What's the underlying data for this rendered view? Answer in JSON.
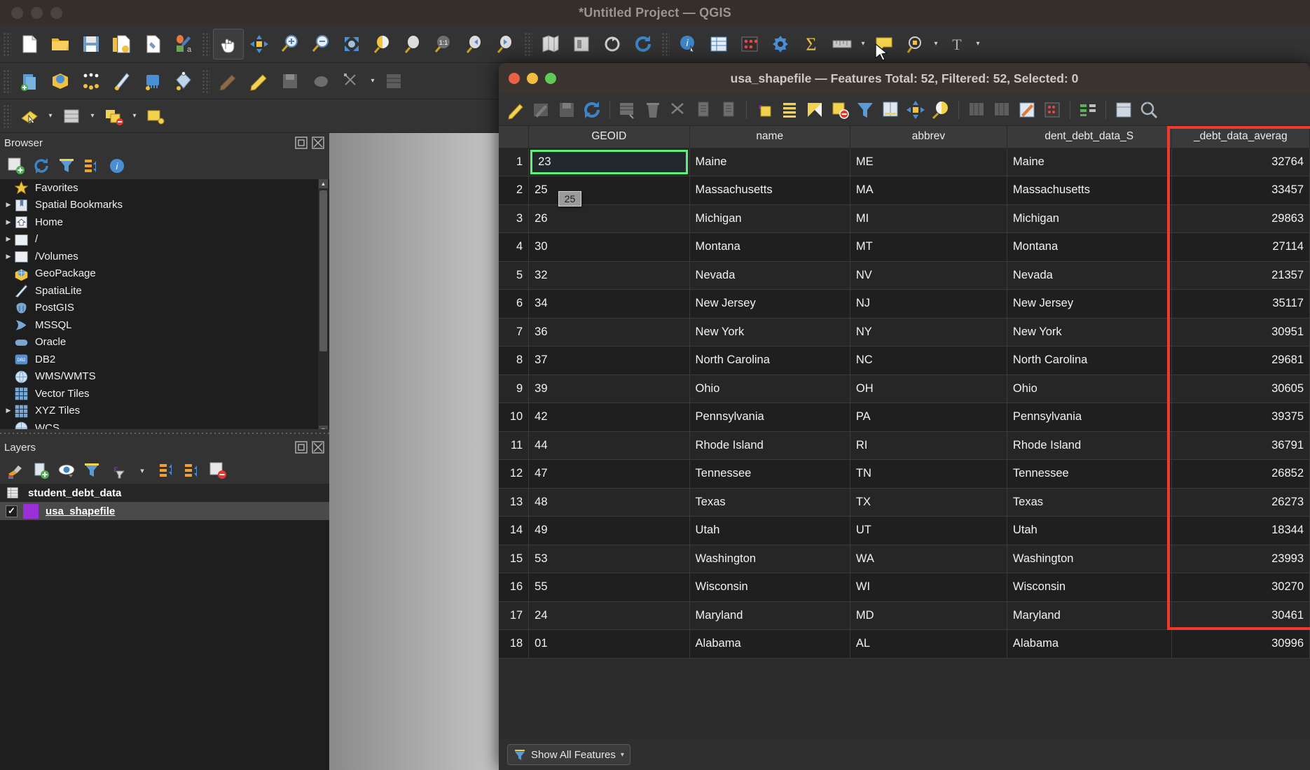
{
  "main_window": {
    "title": "*Untitled Project — QGIS",
    "traffic_lights": [
      "close",
      "minimize",
      "zoom"
    ]
  },
  "toolbar_rows": [
    {
      "name": "project-toolbar",
      "items": [
        {
          "icon": "new-project-icon",
          "label": "New Project"
        },
        {
          "icon": "open-project-icon",
          "label": "Open Project"
        },
        {
          "icon": "save-project-icon",
          "label": "Save Project"
        },
        {
          "icon": "new-print-layout-icon",
          "label": "New Print Layout"
        },
        {
          "icon": "style-manager-icon",
          "label": "Style Manager"
        },
        {
          "icon": "layout-manager-icon",
          "label": "Layout Manager"
        },
        {
          "sep": true
        },
        {
          "icon": "pan-map-icon",
          "label": "Pan Map",
          "active": true
        },
        {
          "icon": "pan-to-selection-icon",
          "label": "Pan Map to Selection"
        },
        {
          "icon": "zoom-in-icon",
          "label": "Zoom In"
        },
        {
          "icon": "zoom-out-icon",
          "label": "Zoom Out"
        },
        {
          "icon": "zoom-full-icon",
          "label": "Zoom Full"
        },
        {
          "icon": "zoom-selection-icon",
          "label": "Zoom to Selection"
        },
        {
          "icon": "zoom-layer-icon",
          "label": "Zoom to Layer"
        },
        {
          "icon": "zoom-native-icon",
          "label": "Zoom to Native Resolution"
        },
        {
          "icon": "zoom-last-icon",
          "label": "Zoom Last"
        },
        {
          "icon": "zoom-next-icon",
          "label": "Zoom Next"
        },
        {
          "sep": true
        },
        {
          "icon": "new-map-view-icon",
          "label": "New Map View"
        },
        {
          "icon": "new-3d-map-view-icon",
          "label": "New 3D Map View"
        },
        {
          "icon": "refresh-icon",
          "label": "Refresh"
        },
        {
          "icon": "reload-icon",
          "label": "Reload"
        },
        {
          "sep": true
        },
        {
          "icon": "identify-features-icon",
          "label": "Identify Features"
        },
        {
          "icon": "open-attribute-table-icon",
          "label": "Open Attribute Table"
        },
        {
          "icon": "statistical-summary-icon",
          "label": "Statistical Summary"
        },
        {
          "icon": "processing-toolbox-icon",
          "label": "Processing Toolbox"
        },
        {
          "icon": "sum-icon",
          "label": "Field Calculator"
        },
        {
          "icon": "measure-line-icon",
          "label": "Measure Line"
        },
        {
          "icon": "map-tips-icon",
          "label": "Show Map Tips"
        },
        {
          "icon": "annotations-icon",
          "label": "Annotations"
        },
        {
          "icon": "text-annotation-icon",
          "label": "Text Annotation"
        }
      ]
    },
    {
      "name": "data-source-toolbar",
      "items": [
        {
          "icon": "data-source-manager-icon",
          "label": "Data Source Manager"
        },
        {
          "icon": "add-vector-layer-icon",
          "label": "Add Vector Layer"
        },
        {
          "icon": "add-delimited-text-icon",
          "label": "Add Delimited Text Layer"
        },
        {
          "icon": "add-spatialite-icon",
          "label": "Add SpatiaLite Layer"
        },
        {
          "icon": "add-postgis-icon",
          "label": "Add PostGIS Layer"
        },
        {
          "icon": "add-mesh-layer-icon",
          "label": "Add Mesh Layer"
        },
        {
          "sep": true
        },
        {
          "icon": "current-edits-icon",
          "label": "Current Edits"
        },
        {
          "icon": "toggle-editing-icon",
          "label": "Toggle Editing"
        },
        {
          "icon": "save-layer-edits-icon",
          "label": "Save Layer Edits"
        },
        {
          "icon": "digitize-shape-icon",
          "label": "Digitize Shape"
        },
        {
          "icon": "vertex-tool-icon",
          "label": "Vertex Tool"
        },
        {
          "icon": "modify-attributes-icon",
          "label": "Modify Attributes of Features"
        }
      ]
    },
    {
      "name": "selection-toolbar",
      "items": [
        {
          "icon": "select-features-icon",
          "label": "Select Features by Area"
        },
        {
          "icon": "select-value-icon",
          "label": "Select Features by Value"
        },
        {
          "icon": "deselect-features-icon",
          "label": "Deselect Features"
        },
        {
          "icon": "select-by-location-icon",
          "label": "Select by Location"
        }
      ]
    }
  ],
  "browser_panel": {
    "title": "Browser",
    "toolbar": [
      {
        "icon": "add-layer-icon",
        "label": "Add Selected Layers"
      },
      {
        "icon": "refresh-icon",
        "label": "Refresh"
      },
      {
        "icon": "filter-browser-icon",
        "label": "Filter Browser"
      },
      {
        "icon": "collapse-all-icon",
        "label": "Collapse All"
      },
      {
        "icon": "properties-info-icon",
        "label": "Properties"
      }
    ],
    "items": [
      {
        "label": "Favorites",
        "icon": "star-icon",
        "expandable": false
      },
      {
        "label": "Spatial Bookmarks",
        "icon": "bookmark-icon",
        "expandable": true
      },
      {
        "label": "Home",
        "icon": "home-icon",
        "expandable": true
      },
      {
        "label": "/",
        "icon": "folder-icon",
        "expandable": true
      },
      {
        "label": "/Volumes",
        "icon": "folder-icon",
        "expandable": true
      },
      {
        "label": "GeoPackage",
        "icon": "geopackage-icon",
        "expandable": false
      },
      {
        "label": "SpatiaLite",
        "icon": "spatialite-icon",
        "expandable": false
      },
      {
        "label": "PostGIS",
        "icon": "postgis-icon",
        "expandable": false
      },
      {
        "label": "MSSQL",
        "icon": "mssql-icon",
        "expandable": false
      },
      {
        "label": "Oracle",
        "icon": "oracle-icon",
        "expandable": false
      },
      {
        "label": "DB2",
        "icon": "db2-icon",
        "expandable": false
      },
      {
        "label": "WMS/WMTS",
        "icon": "wms-icon",
        "expandable": false
      },
      {
        "label": "Vector Tiles",
        "icon": "vector-tiles-icon",
        "expandable": false
      },
      {
        "label": "XYZ Tiles",
        "icon": "xyz-tiles-icon",
        "expandable": true
      },
      {
        "label": "WCS",
        "icon": "wcs-icon",
        "expandable": false
      }
    ]
  },
  "layers_panel": {
    "title": "Layers",
    "toolbar": [
      {
        "icon": "layer-styling-icon",
        "label": "Open Layer Styling Panel"
      },
      {
        "icon": "add-group-icon",
        "label": "Add Group"
      },
      {
        "icon": "manage-visibility-icon",
        "label": "Manage Map Themes"
      },
      {
        "icon": "filter-legend-icon",
        "label": "Filter Legend"
      },
      {
        "icon": "expression-filter-icon",
        "label": "Filter Legend by Expression"
      },
      {
        "icon": "expand-all-icon",
        "label": "Expand All"
      },
      {
        "icon": "collapse-all-icon",
        "label": "Collapse All"
      },
      {
        "icon": "remove-layer-icon",
        "label": "Remove Layer/Group"
      }
    ],
    "layers": [
      {
        "name": "student_debt_data",
        "icon": "table-layer-icon",
        "checked": null,
        "selected": "dark",
        "color": null
      },
      {
        "name": "usa_shapefile",
        "icon": "polygon-layer-icon",
        "checked": true,
        "selected": "light",
        "color": "#9b30d9"
      }
    ]
  },
  "attribute_window": {
    "title": "usa_shapefile — Features Total: 52, Filtered: 52, Selected: 0",
    "toolbar": [
      {
        "icon": "toggle-editing-pencil-icon",
        "label": "Toggle Editing Mode"
      },
      {
        "icon": "multi-edit-icon",
        "label": "Toggle Multi Edit Mode"
      },
      {
        "icon": "save-edits-icon",
        "label": "Save Edits"
      },
      {
        "icon": "reload-table-icon",
        "label": "Reload Table"
      },
      {
        "sep": true
      },
      {
        "icon": "add-feature-icon",
        "label": "Add Feature"
      },
      {
        "icon": "delete-selected-icon",
        "label": "Delete Selected Features"
      },
      {
        "icon": "cut-features-icon",
        "label": "Cut Selected Features"
      },
      {
        "icon": "copy-features-icon",
        "label": "Copy Selected Features"
      },
      {
        "icon": "paste-features-icon",
        "label": "Paste Features"
      },
      {
        "sep": true
      },
      {
        "icon": "select-by-expression-icon",
        "label": "Select Features Using an Expression"
      },
      {
        "icon": "select-all-icon",
        "label": "Select All"
      },
      {
        "icon": "invert-selection-icon",
        "label": "Invert Selection"
      },
      {
        "icon": "deselect-all-icon",
        "label": "Deselect All"
      },
      {
        "icon": "filter-expression-icon",
        "label": "Filter / Select Using Form"
      },
      {
        "icon": "move-selection-top-icon",
        "label": "Move Selection to Top"
      },
      {
        "icon": "pan-to-selected-icon",
        "label": "Pan Map to Selected Rows"
      },
      {
        "icon": "zoom-to-selected-icon",
        "label": "Zoom Map to Selected Rows"
      },
      {
        "sep": true
      },
      {
        "icon": "new-field-icon",
        "label": "New Field"
      },
      {
        "icon": "delete-field-icon",
        "label": "Delete Field"
      },
      {
        "icon": "open-field-calculator-icon",
        "label": "Open Field Calculator"
      },
      {
        "icon": "conditional-formatting-icon",
        "label": "Conditional Formatting"
      },
      {
        "sep": true
      },
      {
        "icon": "organize-columns-icon",
        "label": "Organize Columns"
      },
      {
        "sep": true
      },
      {
        "icon": "actions-icon",
        "label": "Actions"
      },
      {
        "icon": "form-view-icon",
        "label": "Switch to Form View"
      }
    ],
    "columns": [
      "GEOID",
      "name",
      "abbrev",
      "dent_debt_data_S",
      "_debt_data_averag"
    ],
    "rows": [
      {
        "n": "1",
        "geoid": "23",
        "name": "Maine",
        "abbrev": "ME",
        "state": "Maine",
        "avg": "32764"
      },
      {
        "n": "2",
        "geoid": "25",
        "name": "Massachusetts",
        "abbrev": "MA",
        "state": "Massachusetts",
        "avg": "33457"
      },
      {
        "n": "3",
        "geoid": "26",
        "name": "Michigan",
        "abbrev": "MI",
        "state": "Michigan",
        "avg": "29863"
      },
      {
        "n": "4",
        "geoid": "30",
        "name": "Montana",
        "abbrev": "MT",
        "state": "Montana",
        "avg": "27114"
      },
      {
        "n": "5",
        "geoid": "32",
        "name": "Nevada",
        "abbrev": "NV",
        "state": "Nevada",
        "avg": "21357"
      },
      {
        "n": "6",
        "geoid": "34",
        "name": "New Jersey",
        "abbrev": "NJ",
        "state": "New Jersey",
        "avg": "35117"
      },
      {
        "n": "7",
        "geoid": "36",
        "name": "New York",
        "abbrev": "NY",
        "state": "New York",
        "avg": "30951"
      },
      {
        "n": "8",
        "geoid": "37",
        "name": "North Carolina",
        "abbrev": "NC",
        "state": "North Carolina",
        "avg": "29681"
      },
      {
        "n": "9",
        "geoid": "39",
        "name": "Ohio",
        "abbrev": "OH",
        "state": "Ohio",
        "avg": "30605"
      },
      {
        "n": "10",
        "geoid": "42",
        "name": "Pennsylvania",
        "abbrev": "PA",
        "state": "Pennsylvania",
        "avg": "39375"
      },
      {
        "n": "11",
        "geoid": "44",
        "name": "Rhode Island",
        "abbrev": "RI",
        "state": "Rhode Island",
        "avg": "36791"
      },
      {
        "n": "12",
        "geoid": "47",
        "name": "Tennessee",
        "abbrev": "TN",
        "state": "Tennessee",
        "avg": "26852"
      },
      {
        "n": "13",
        "geoid": "48",
        "name": "Texas",
        "abbrev": "TX",
        "state": "Texas",
        "avg": "26273"
      },
      {
        "n": "14",
        "geoid": "49",
        "name": "Utah",
        "abbrev": "UT",
        "state": "Utah",
        "avg": "18344"
      },
      {
        "n": "15",
        "geoid": "53",
        "name": "Washington",
        "abbrev": "WA",
        "state": "Washington",
        "avg": "23993"
      },
      {
        "n": "16",
        "geoid": "55",
        "name": "Wisconsin",
        "abbrev": "WI",
        "state": "Wisconsin",
        "avg": "30270"
      },
      {
        "n": "17",
        "geoid": "24",
        "name": "Maryland",
        "abbrev": "MD",
        "state": "Maryland",
        "avg": "30461"
      },
      {
        "n": "18",
        "geoid": "01",
        "name": "Alabama",
        "abbrev": "AL",
        "state": "Alabama",
        "avg": "30996"
      }
    ],
    "selected_cell": {
      "row": 1,
      "column": "GEOID",
      "value": "23"
    },
    "tooltip": "25",
    "highlight_color": "#f0392b",
    "selection_color": "#5ff07a",
    "status": {
      "filter_label": "Show All Features"
    }
  }
}
